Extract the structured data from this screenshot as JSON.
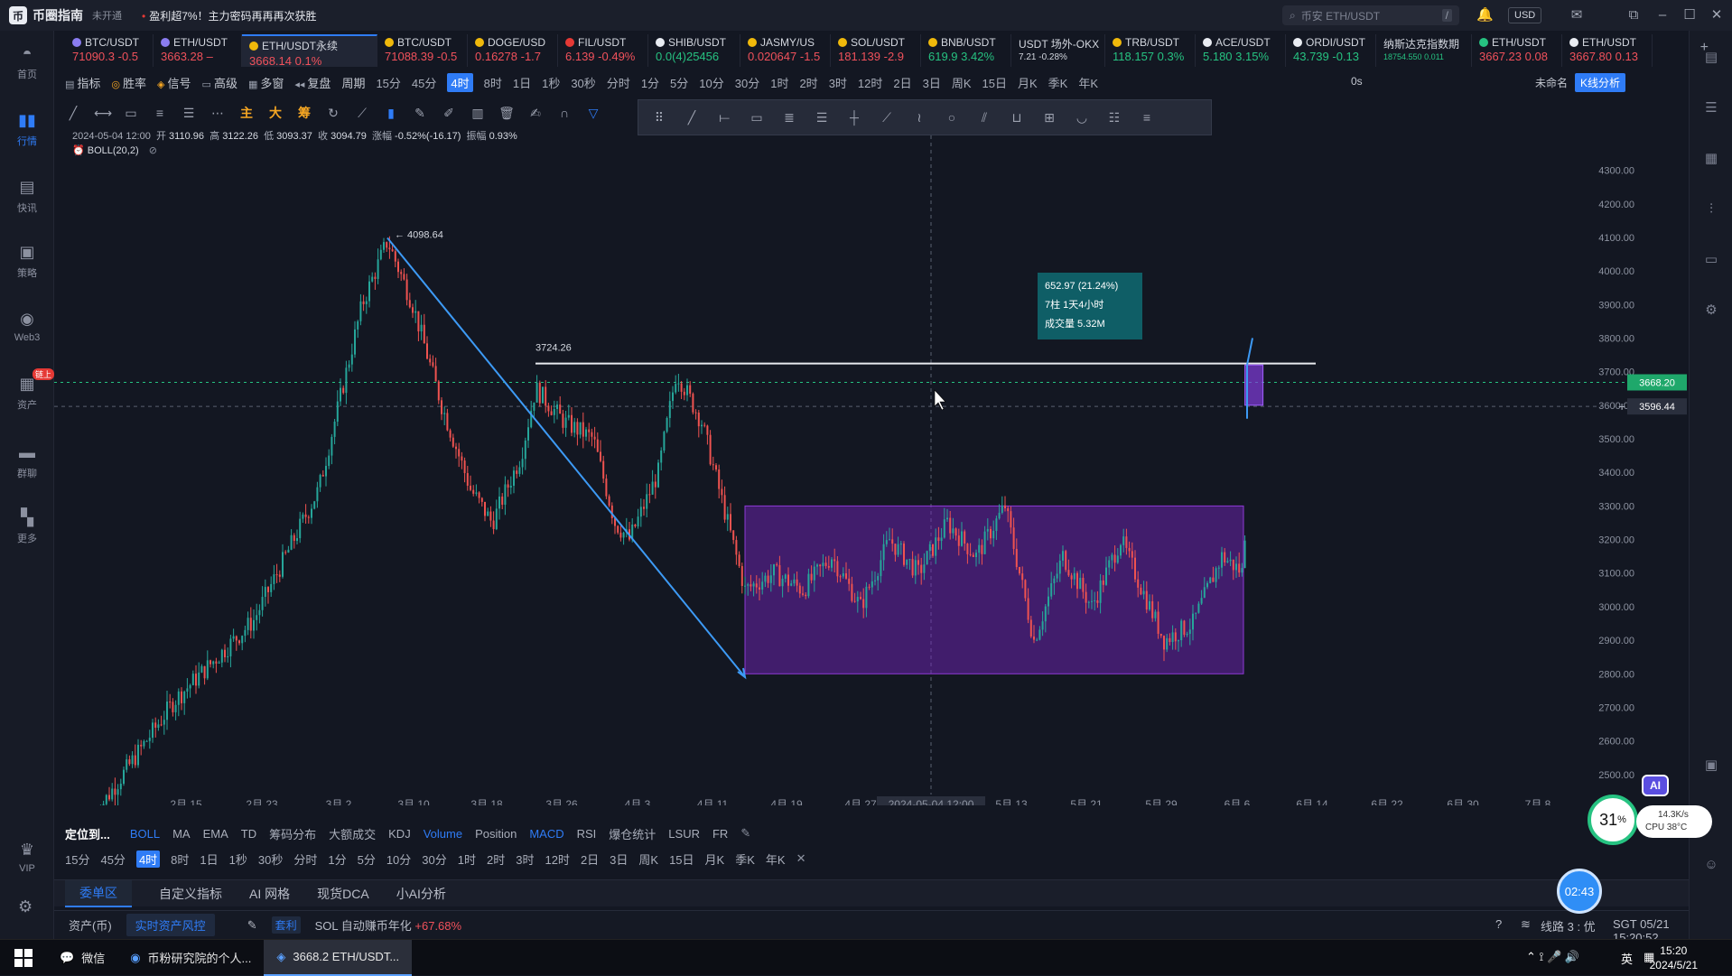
{
  "app": {
    "name": "币圈指南",
    "status": "未开通",
    "promo": "盈利超7%！主力密码再再再次获胜",
    "search_placeholder": "币安 ETH/USDT",
    "search_key": "/",
    "currency": "USD"
  },
  "sidebar": [
    {
      "label": "首页",
      "icon": "home-icon"
    },
    {
      "label": "行情",
      "icon": "chart-icon",
      "active": true
    },
    {
      "label": "快讯",
      "icon": "news-icon"
    },
    {
      "label": "策略",
      "icon": "strategy-icon"
    },
    {
      "label": "Web3",
      "icon": "web3-icon"
    },
    {
      "label": "资产",
      "icon": "wallet-icon",
      "badge": "链上"
    },
    {
      "label": "群聊",
      "icon": "chat-icon"
    },
    {
      "label": "更多",
      "icon": "more-icon"
    },
    {
      "label": "VIP",
      "icon": "vip-icon"
    }
  ],
  "tickers": [
    {
      "name": "BTC/USDT",
      "price": "71090.3",
      "change": "-0.5",
      "dir": "dn",
      "coin": "#8a7cf0"
    },
    {
      "name": "ETH/USDT",
      "price": "3663.28",
      "change": "–",
      "dir": "dn",
      "coin": "#8a7cf0"
    },
    {
      "name": "ETH/USDT永续",
      "price": "3668.14",
      "change": "0.1%",
      "dir": "dn",
      "coin": "#f0b90b",
      "active": true
    },
    {
      "name": "BTC/USDT",
      "price": "71088.39",
      "change": "-0.5",
      "dir": "dn",
      "coin": "#f0b90b"
    },
    {
      "name": "DOGE/USD",
      "price": "0.16278",
      "change": "-1.7",
      "dir": "dn",
      "coin": "#f0b90b"
    },
    {
      "name": "FIL/USDT",
      "price": "6.139",
      "change": "-0.49%",
      "dir": "dn",
      "coin": "#e53935"
    },
    {
      "name": "SHIB/USDT",
      "price": "0.0(4)25456",
      "change": "",
      "dir": "up",
      "coin": "#e9ecf2"
    },
    {
      "name": "JASMY/US",
      "price": "0.020647",
      "change": "-1.5",
      "dir": "dn",
      "coin": "#f0b90b"
    },
    {
      "name": "SOL/USDT",
      "price": "181.139",
      "change": "-2.9",
      "dir": "dn",
      "coin": "#f0b90b"
    },
    {
      "name": "BNB/USDT",
      "price": "619.9",
      "change": "3.42%",
      "dir": "up",
      "coin": "#f0b90b"
    },
    {
      "name": "USDT 场外-OKX",
      "price": "7.21",
      "change": "-0.28%",
      "dir": "flat",
      "coin": ""
    },
    {
      "name": "TRB/USDT",
      "price": "118.157",
      "change": "0.3%",
      "dir": "up",
      "coin": "#f0b90b"
    },
    {
      "name": "ACE/USDT",
      "price": "5.180",
      "change": "3.15%",
      "dir": "up",
      "coin": "#e9ecf2"
    },
    {
      "name": "ORDI/USDT",
      "price": "43.739",
      "change": "-0.13",
      "dir": "up",
      "coin": "#e9ecf2"
    },
    {
      "name": "纳斯达克指数期",
      "price": "18754.550",
      "change": "0.011",
      "dir": "up",
      "coin": ""
    },
    {
      "name": "ETH/USDT",
      "price": "3667.23",
      "change": "0.08",
      "dir": "dn",
      "coin": "#26c281"
    },
    {
      "name": "ETH/USDT",
      "price": "3667.80",
      "change": "0.13",
      "dir": "dn",
      "coin": "#e9ecf2"
    }
  ],
  "toolbar1": {
    "items": [
      "指标",
      "胜率",
      "信号",
      "高级",
      "多窗",
      "复盘",
      "周期"
    ],
    "timeframes": [
      "15分",
      "45分",
      "4时",
      "8时",
      "1日",
      "1秒",
      "30秒",
      "分时",
      "1分",
      "5分",
      "10分",
      "30分",
      "1时",
      "2时",
      "3时",
      "12时",
      "2日",
      "3日",
      "周K",
      "15日",
      "月K",
      "季K",
      "年K"
    ],
    "active_tf": "4时",
    "right_zero": "0s",
    "unnamed": "未命名",
    "kline_analysis": "K线分析"
  },
  "ohlc": {
    "date": "2024-05-04 12:00",
    "open_label": "开",
    "open": "3110.96",
    "high_label": "高",
    "high": "3122.26",
    "low_label": "低",
    "low": "3093.37",
    "close_label": "收",
    "close": "3094.79",
    "change_label": "涨幅",
    "change": "-0.52%(-16.17)",
    "amp_label": "振幅",
    "amp": "0.93%",
    "indicator": "BOLL(20,2)"
  },
  "chart_data": {
    "type": "candlestick",
    "symbol": "ETH/USDT永续",
    "ylim": [
      2400,
      4350
    ],
    "y_ticks": [
      2500,
      2600,
      2700,
      2800,
      2900,
      3000,
      3100,
      3200,
      3300,
      3400,
      3500,
      3600,
      3700,
      3800,
      3900,
      4000,
      4100,
      4200,
      4300
    ],
    "x_ticks": [
      "2月 15",
      "2月 23",
      "3月 2",
      "3月 10",
      "3月 18",
      "3月 26",
      "4月 3",
      "4月 11",
      "4月 19",
      "4月 27",
      "2024-05-04 12:00",
      "5月 13",
      "5月 21",
      "5月 29",
      "6月 6",
      "6月 14",
      "6月 22",
      "6月 30",
      "7月 8"
    ],
    "price_path": [
      [
        0,
        2380
      ],
      [
        1.1,
        2720
      ],
      [
        2.2,
        2960
      ],
      [
        3.1,
        3350
      ],
      [
        3.7,
        3900
      ],
      [
        4.05,
        4090
      ],
      [
        4.4,
        3900
      ],
      [
        4.8,
        3600
      ],
      [
        5.2,
        3350
      ],
      [
        5.5,
        3250
      ],
      [
        5.9,
        3450
      ],
      [
        6.1,
        3650
      ],
      [
        6.5,
        3550
      ],
      [
        6.9,
        3500
      ],
      [
        7.2,
        3250
      ],
      [
        7.4,
        3200
      ],
      [
        7.8,
        3400
      ],
      [
        8.05,
        3700
      ],
      [
        8.4,
        3550
      ],
      [
        8.7,
        3300
      ],
      [
        9.0,
        3050
      ],
      [
        9.4,
        3100
      ],
      [
        9.8,
        3050
      ],
      [
        10.2,
        3150
      ],
      [
        10.6,
        3000
      ],
      [
        11.0,
        3200
      ],
      [
        11.4,
        3100
      ],
      [
        11.8,
        3250
      ],
      [
        12.2,
        3150
      ],
      [
        12.6,
        3300
      ],
      [
        13.0,
        2900
      ],
      [
        13.4,
        3150
      ],
      [
        13.8,
        3000
      ],
      [
        14.2,
        3200
      ],
      [
        14.5,
        3050
      ],
      [
        14.8,
        2900
      ],
      [
        15.2,
        2950
      ],
      [
        15.6,
        3150
      ],
      [
        15.9,
        3100
      ],
      [
        16.0,
        3700
      ]
    ],
    "annotations": {
      "peak_label": "4098.64",
      "resistance_label": "3724.26",
      "resistance_price": 3724.26,
      "measure_lines": [
        "652.97 (21.24%)",
        "7柱 1天4小时",
        "成交量 5.32M"
      ],
      "last_price": "3668.20",
      "crosshair_price": "3596.44",
      "crosshair_time": "2024-05-04 12:00",
      "range_box": {
        "from": 9.0,
        "to": 15.9,
        "low": 2800,
        "high": 3300
      }
    }
  },
  "bottom_indicators": [
    "定位到...",
    "BOLL",
    "MA",
    "EMA",
    "TD",
    "筹码分布",
    "大额成交",
    "KDJ",
    "Volume",
    "Position",
    "MACD",
    "RSI",
    "爆仓统计",
    "LSUR",
    "FR"
  ],
  "bottom_timeframes": [
    "15分",
    "45分",
    "4时",
    "8时",
    "1日",
    "1秒",
    "30秒",
    "分时",
    "1分",
    "5分",
    "10分",
    "30分",
    "1时",
    "2时",
    "3时",
    "12时",
    "2日",
    "3日",
    "周K",
    "15日",
    "月K",
    "季K",
    "年K"
  ],
  "panel_tabs": [
    "委单区",
    "自定义指标",
    "AI 网格",
    "现货DCA",
    "小AI分析"
  ],
  "status": {
    "asset": "资产(币)",
    "risk": "实时资产风控",
    "tag": "套利",
    "text": "SOL 自动赚币年化",
    "value": "+67.68%",
    "line": "线路 3 : 优",
    "time": "SGT 05/21 15:20:52"
  },
  "widgets": {
    "gauge": "31",
    "gauge_unit": "%",
    "net": "14.3K/s",
    "cpu": "CPU 38°C",
    "ai": "AI",
    "timer": "02:43"
  },
  "taskbar": {
    "apps": [
      {
        "label": "微信",
        "icon": "wechat-icon"
      },
      {
        "label": "币粉研究院的个人...",
        "icon": "chrome-icon"
      },
      {
        "label": "3668.2 ETH/USDT...",
        "icon": "app-icon",
        "active": true
      }
    ],
    "ime": "英",
    "time": "15:20",
    "date": "2024/5/21"
  }
}
